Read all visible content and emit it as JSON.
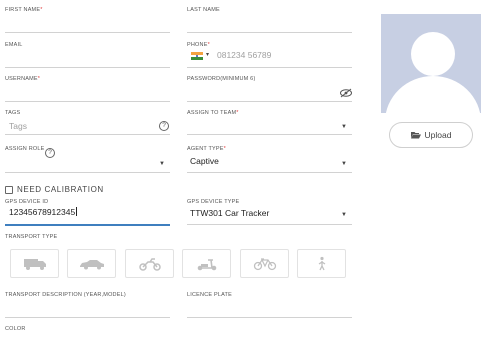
{
  "form": {
    "first_name": {
      "label": "FIRST NAME",
      "required": "*"
    },
    "last_name": {
      "label": "LAST NAME"
    },
    "email": {
      "label": "EMAIL"
    },
    "phone": {
      "label": "PHONE",
      "required": "*",
      "placeholder": "081234 56789",
      "country_flag": "flag-india-icon"
    },
    "username": {
      "label": "USERNAME",
      "required": "*"
    },
    "password": {
      "label": "PASSWORD(MINIMUM 6)",
      "toggle_icon": "eye-slash-icon"
    },
    "tags": {
      "label": "TAGS",
      "placeholder": "Tags",
      "help": "?"
    },
    "assign_to_team": {
      "label": "ASSIGN TO TEAM",
      "required": "*"
    },
    "assign_role": {
      "label": "ASSIGN ROLE",
      "help": "?"
    },
    "agent_type": {
      "label": "AGENT TYPE",
      "required": "*",
      "value": "Captive"
    },
    "need_calibration": {
      "label": "NEED CALIBRATION",
      "checked": false
    },
    "gps_device_id": {
      "label": "GPS DEVICE ID",
      "value": "12345678912345"
    },
    "gps_device_type": {
      "label": "GPS DEVICE TYPE",
      "value": "TTW301 Car Tracker"
    },
    "transport_type": {
      "label": "TRANSPORT TYPE",
      "options": [
        "truck-icon",
        "car-icon",
        "motorcycle-icon",
        "scooter-icon",
        "bicycle-icon",
        "walking-person-icon"
      ]
    },
    "transport_description": {
      "label": "TRANSPORT DESCRIPTION (YEAR,MODEL)"
    },
    "licence_plate": {
      "label": "LICENCE PLATE"
    },
    "color": {
      "label": "COLOR"
    }
  },
  "profile": {
    "upload_label": "Upload",
    "upload_icon": "folder-open-icon",
    "avatar_icon": "default-avatar-icon"
  },
  "colors": {
    "required": "#e03a3a",
    "focus": "#3f7fbf",
    "avatar_bg": "#c7cfe3",
    "icon": "#c0c0c0"
  }
}
